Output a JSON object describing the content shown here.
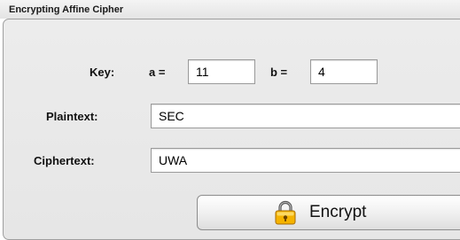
{
  "window": {
    "title": "Encrypting Affine Cipher"
  },
  "key": {
    "label": "Key:",
    "a_label": "a =",
    "a_value": "11",
    "b_label": "b =",
    "b_value": "4"
  },
  "plaintext": {
    "label": "Plaintext:",
    "value": "SEC"
  },
  "ciphertext": {
    "label": "Ciphertext:",
    "value": "UWA"
  },
  "encrypt_button": {
    "label": "Encrypt",
    "icon": "lock-icon"
  },
  "colors": {
    "lock_body": "#f5b300",
    "lock_shackle": "#555555"
  }
}
